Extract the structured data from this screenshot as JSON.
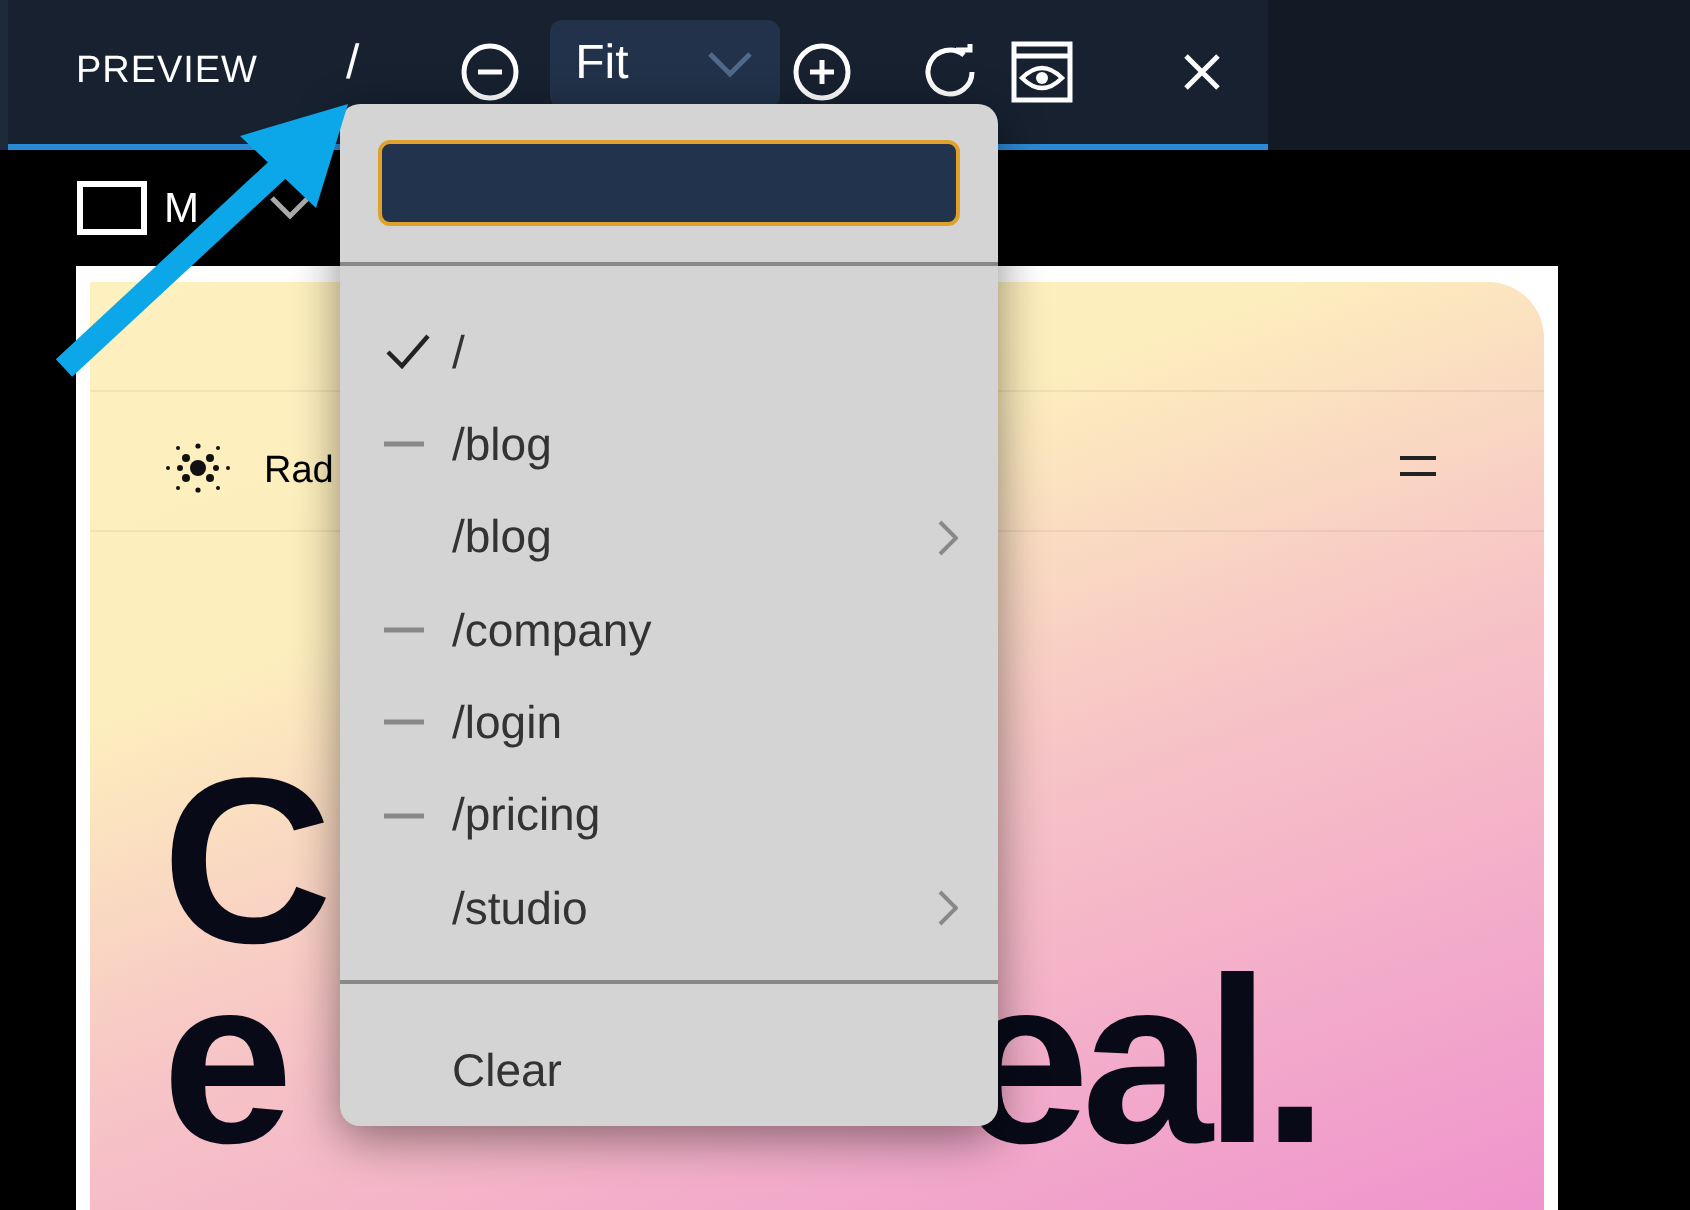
{
  "toolbar": {
    "title": "PREVIEW",
    "path": "/",
    "zoom": "Fit"
  },
  "device": {
    "label": "M"
  },
  "preview": {
    "logo_text": "Rad",
    "headline": {
      "line_1": "C",
      "line_2_left": "e",
      "line_2_right": "eal."
    }
  },
  "route_menu": {
    "items": [
      {
        "label": "/",
        "selected": true,
        "dashed": false,
        "submenu": false
      },
      {
        "label": "/blog",
        "selected": false,
        "dashed": true,
        "submenu": false
      },
      {
        "label": "/blog",
        "selected": false,
        "dashed": false,
        "submenu": true
      },
      {
        "label": "/company",
        "selected": false,
        "dashed": true,
        "submenu": false
      },
      {
        "label": "/login",
        "selected": false,
        "dashed": true,
        "submenu": false
      },
      {
        "label": "/pricing",
        "selected": false,
        "dashed": true,
        "submenu": false
      },
      {
        "label": "/studio",
        "selected": false,
        "dashed": false,
        "submenu": true
      }
    ],
    "footer": "Clear"
  }
}
